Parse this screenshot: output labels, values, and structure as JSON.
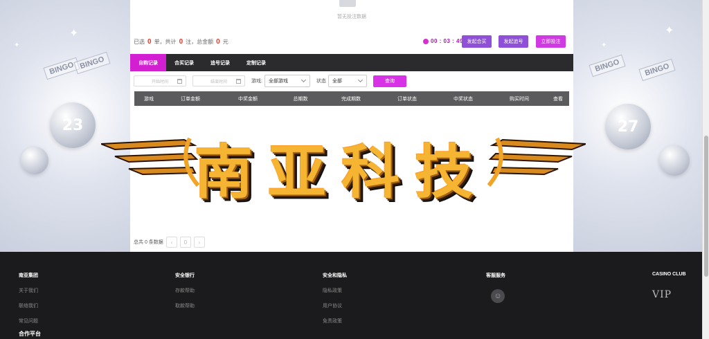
{
  "empty": {
    "text": "暂无投注数据"
  },
  "summary": {
    "p1": "已选",
    "count_orders": "0",
    "p2": "单，共计",
    "count_bets": "0",
    "p3": "注，总金额",
    "amount": "0",
    "p4": "元"
  },
  "timer": "00 : 03 : 49",
  "buttons": {
    "group_buy": "发起合买",
    "chase": "发起追号",
    "bet_now": "立即投注"
  },
  "tabs": [
    "自购记录",
    "合买记录",
    "追号记录",
    "定制记录"
  ],
  "filters": {
    "start_date_placeholder": "开始时间",
    "end_date_placeholder": "结束时间",
    "game_label": "游戏:",
    "game_value": "全部游戏",
    "status_label": "状态",
    "status_value": "全部",
    "query_label": "查询"
  },
  "table": {
    "headers": [
      "游戏",
      "订单金额",
      "中奖金额",
      "总期数",
      "完成期数",
      "订单状态",
      "中奖状态",
      "购买时间",
      "查看"
    ]
  },
  "pager": {
    "total": "总共 0 条数据",
    "prev": "‹",
    "current": "0",
    "next": "›"
  },
  "watermark": "南亚科技",
  "decor": {
    "ball_left": "23",
    "ball_right": "27",
    "bingo": "BINGO"
  },
  "footer": {
    "col1": {
      "title": "南亚集团",
      "links": [
        "关于我们",
        "联络我们",
        "常见问题"
      ]
    },
    "col2": {
      "title": "安全银行",
      "links": [
        "存款帮助",
        "取款帮助"
      ]
    },
    "col3": {
      "title": "安全和隐私",
      "links": [
        "隐私政策",
        "用户协议",
        "免责政策"
      ]
    },
    "col4": {
      "title": "客服服务"
    },
    "col5": {
      "title": "CASINO CLUB",
      "vip": "VIP"
    },
    "partner_title": "合作平台"
  },
  "colors": {
    "accent": "#d21fd1",
    "timer": "#9e1fa8",
    "tab_bar": "#2b2b2e",
    "footer": "#1b1b1d",
    "number_red": "#e6392a"
  }
}
